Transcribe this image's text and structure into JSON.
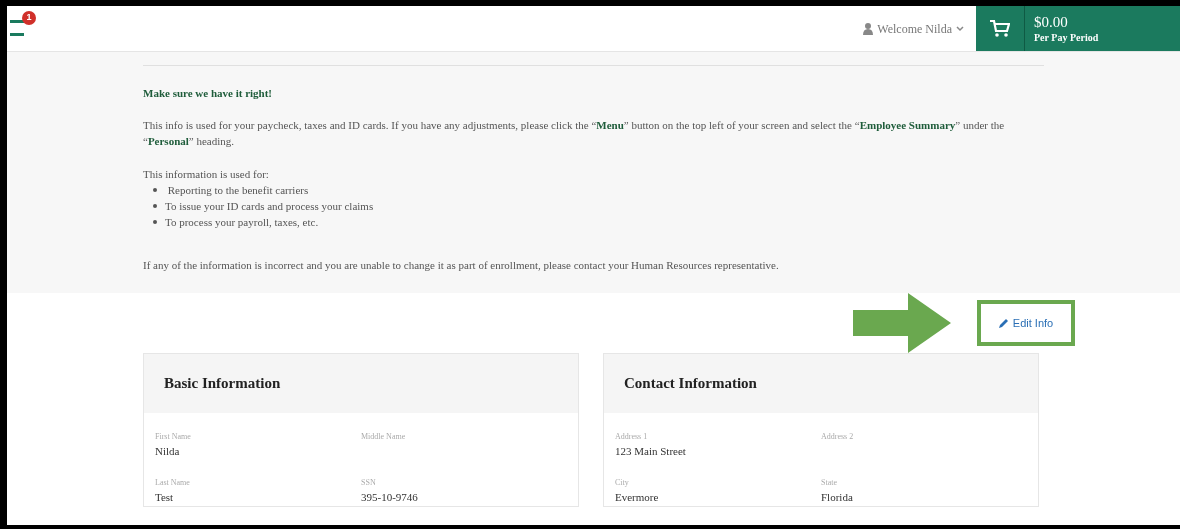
{
  "header": {
    "notification_count": "1",
    "welcome": "Welcome Nilda",
    "cart_total": "$0.00",
    "cart_period": "Per Pay Period"
  },
  "notice": {
    "title": "Make sure we have it right!",
    "paragraph": "This info is used for your paycheck, taxes and ID cards. If you have any adjustments, please click the “**Menu**” button on the top left of your screen and select the “**Employee Summary**” under the “**Personal**” heading.",
    "list_intro": "This information is used for:",
    "list_items": [
      " Reporting to the benefit carriers",
      "To issue your ID cards and process your claims",
      "To process your payroll, taxes, etc."
    ],
    "footer": "If any of the information is incorrect and you are unable to change it as part of enrollment, please contact your Human Resources representative."
  },
  "edit_link": "Edit Info",
  "cards": [
    {
      "title": "Basic Information",
      "fields": [
        {
          "label": "First Name",
          "value": "Nilda"
        },
        {
          "label": "Middle Name"
        },
        {
          "label": "Last Name",
          "value": "Test"
        },
        {
          "label": "SSN",
          "value": "395-10-9746"
        }
      ]
    },
    {
      "title": "Contact Information",
      "fields": [
        {
          "label": "Address 1",
          "value": "123 Main Street"
        },
        {
          "label": "Address 2"
        },
        {
          "label": "City",
          "value": "Evermore"
        },
        {
          "label": "State",
          "value": "Florida"
        }
      ]
    }
  ]
}
